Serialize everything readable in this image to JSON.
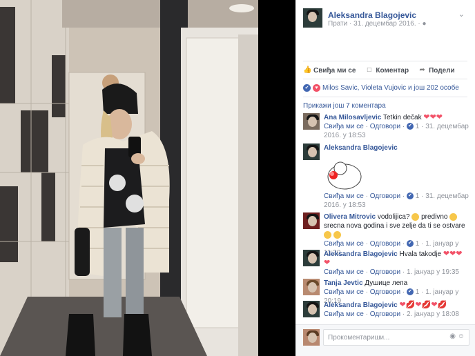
{
  "post": {
    "author": "Aleksandra Blagojevic",
    "follow": "Прати",
    "date": "31. децембар 2016.",
    "audience_icon": "globe-icon",
    "dot": "·",
    "menu_icon": "chevron-down-icon"
  },
  "actions": {
    "like": "Свиђа ми се",
    "comment": "Коментар",
    "share": "Подели"
  },
  "reactions": {
    "text": "Milos Savic, Violeta Vujovic и још 202 особе"
  },
  "more_comments": "Прикажи још 7 коментара",
  "comments": [
    {
      "name": "Ana Milosavljevic",
      "text": "Tetkin dečak",
      "hearts": "❤❤❤",
      "like": "Свиђа ми се",
      "reply": "Одговори",
      "dot": "·",
      "likes": "1",
      "time": "31. децембар 2016. у 18:53"
    },
    {
      "name": "Aleksandra Blagojevic",
      "text": "",
      "like": "Свиђа ми се",
      "reply": "Одговори",
      "dot": "·",
      "likes": "1",
      "time": "31. децембар 2016. у 18:53"
    },
    {
      "name": "Olivera Mitrovic",
      "text1": "vodolijica?",
      "text2": "predivno",
      "text3": "srecna nova godina i sve zelje da ti se ostvare",
      "like": "Свиђа ми се",
      "reply": "Одговори",
      "dot": "·",
      "likes": "1",
      "time": "1. јануар у 11:20"
    },
    {
      "name": "Aleksandra Blagojevic",
      "text": "Hvala takodje",
      "hearts": "❤❤❤",
      "heart2": "❤",
      "like": "Свиђа ми се",
      "reply": "Одговори",
      "dot": "·",
      "time": "1. јануар у 19:35"
    },
    {
      "name": "Tanja Jevtic",
      "text": "Душице лепа",
      "like": "Свиђа ми се",
      "reply": "Одговори",
      "dot": "·",
      "likes": "1",
      "time": "1. јануар у 20:19"
    },
    {
      "name": "Aleksandra Blagojevic",
      "hearts": "❤💋❤💋❤💋",
      "like": "Свиђа ми се",
      "reply": "Одговори",
      "dot": "·",
      "time": "2. јануар у 18:08"
    }
  ],
  "composer": {
    "placeholder": "Прокоментариши...",
    "camera_icon": "camera-icon",
    "emoji_icon": "emoji-icon"
  },
  "colors": {
    "link": "#365899",
    "muted": "#90949c",
    "like_blue": "#4267b2",
    "heart_red": "#f25268"
  }
}
